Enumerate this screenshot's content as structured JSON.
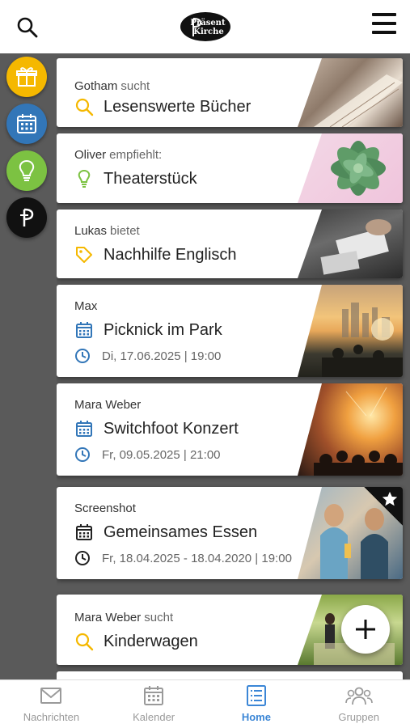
{
  "header": {
    "logo_line1": "Präsent",
    "logo_line2": "Kirche"
  },
  "rail": {
    "items": [
      {
        "name": "gift",
        "color": "#f5b800"
      },
      {
        "name": "calendar",
        "color": "#3276b8"
      },
      {
        "name": "lightbulb",
        "color": "#7cc242"
      },
      {
        "name": "praesent-logo",
        "color": "#111111"
      }
    ]
  },
  "cards": [
    {
      "author": "Gotham",
      "verb": "sucht",
      "icon": "search-icon",
      "title": "Lesenswerte Bücher"
    },
    {
      "author": "Oliver",
      "verb": "empfiehlt:",
      "icon": "lightbulb-icon",
      "title": "Theaterstück"
    },
    {
      "author": "Lukas",
      "verb": "bietet",
      "icon": "tag-icon",
      "title": "Nachhilfe Englisch"
    },
    {
      "author": "Max",
      "verb": "",
      "icon": "calendar-icon",
      "title": "Picknick im Park",
      "date": "Di, 17.06.2025 | 19:00"
    },
    {
      "author": "Mara Weber",
      "verb": "",
      "icon": "calendar-icon",
      "title": "Switchfoot Konzert",
      "date": "Fr, 09.05.2025 | 21:00"
    },
    {
      "author": "Screenshot",
      "verb": "",
      "icon": "calendar-icon",
      "title": "Gemeinsames Essen",
      "date": "Fr, 18.04.2025 - 18.04.2020 | 19:00",
      "starred": true
    },
    {
      "author": "Mara Weber",
      "verb": "sucht",
      "icon": "search-icon",
      "title": "Kinderwagen"
    }
  ],
  "bottom_nav": {
    "items": [
      {
        "label": "Nachrichten",
        "icon": "envelope-icon",
        "active": false
      },
      {
        "label": "Kalender",
        "icon": "calendar-icon",
        "active": false
      },
      {
        "label": "Home",
        "icon": "list-icon",
        "active": true
      },
      {
        "label": "Gruppen",
        "icon": "group-icon",
        "active": false
      }
    ]
  },
  "colors": {
    "accent": "#3b86d6",
    "search_yellow": "#f5b800",
    "idea_green": "#7cc242",
    "event_blue": "#3276b8"
  }
}
